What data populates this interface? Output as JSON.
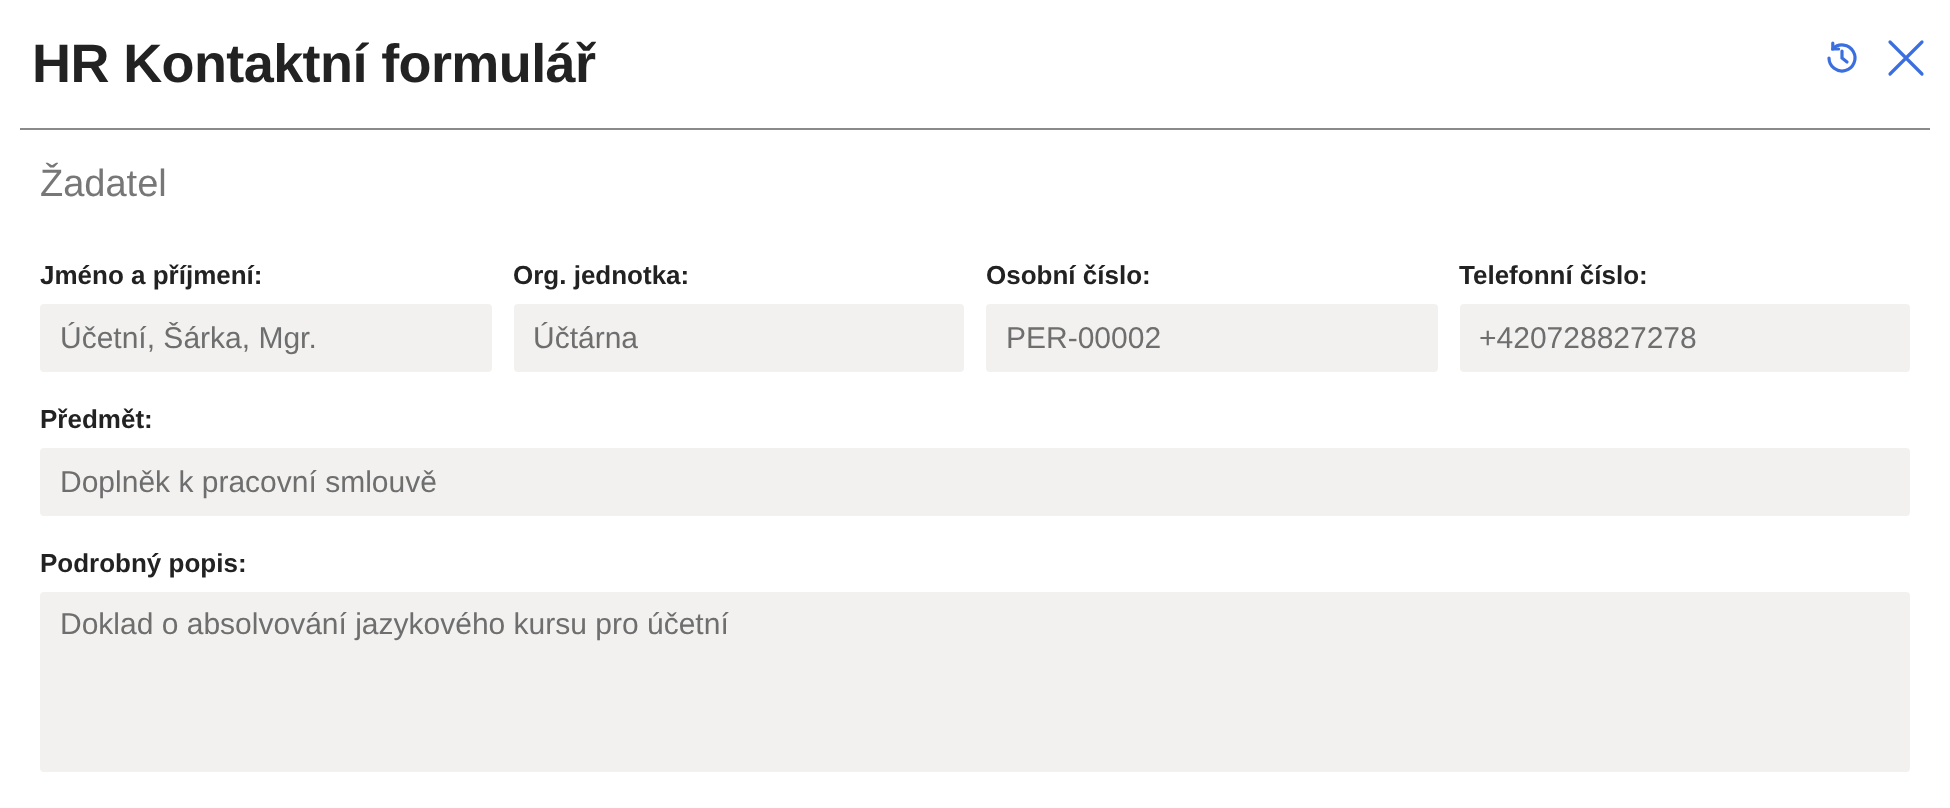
{
  "header": {
    "title": "HR Kontaktní formulář"
  },
  "section": {
    "title": "Žadatel"
  },
  "rows": [
    {
      "fields": [
        {
          "label": "Jméno a příjmení:",
          "value": "Účetní, Šárka, Mgr.",
          "kind": "input"
        },
        {
          "label": "Org. jednotka:",
          "value": "Účtárna",
          "kind": "input"
        },
        {
          "label": "Osobní číslo:",
          "value": "PER-00002",
          "kind": "input"
        },
        {
          "label": "Telefonní číslo:",
          "value": "+420728827278",
          "kind": "input"
        }
      ]
    },
    {
      "fields": [
        {
          "label": "Předmět:",
          "value": "Doplněk k pracovní smlouvě",
          "kind": "input"
        }
      ]
    },
    {
      "fields": [
        {
          "label": "Podrobný popis:",
          "value": "Doklad o absolvování jazykového kursu pro účetní",
          "kind": "textarea"
        }
      ]
    }
  ]
}
